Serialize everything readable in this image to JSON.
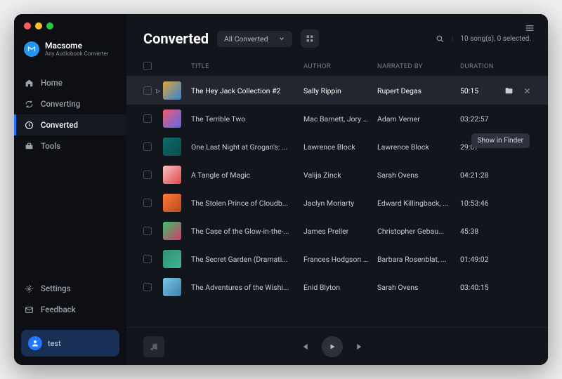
{
  "brand": {
    "name": "Macsome",
    "subtitle": "Any Audiobook Converter"
  },
  "nav": {
    "home": "Home",
    "converting": "Converting",
    "converted": "Converted",
    "tools": "Tools",
    "settings": "Settings",
    "feedback": "Feedback"
  },
  "user": {
    "name": "test"
  },
  "page": {
    "title": "Converted",
    "filter_label": "All Converted",
    "status_count": "10 song(s), 0 selected."
  },
  "columns": {
    "title": "TITLE",
    "author": "Author",
    "narrated": "Narrated by",
    "duration": "DURATION"
  },
  "tooltip": {
    "show_in_finder": "Show in Finder"
  },
  "rows": [
    {
      "title": "The Hey Jack Collection #2",
      "author": "Sally Rippin",
      "narrated": "Rupert Degas",
      "duration": "50:15",
      "art": "#e6a23c",
      "art2": "#2b86d9",
      "active": true
    },
    {
      "title": "The Terrible Two",
      "author": "Mac Barnett, Jory J...",
      "narrated": "Adam Verner",
      "duration": "03:22:57",
      "art": "#f05b6a",
      "art2": "#5b6af0"
    },
    {
      "title": "One Last Night at Grogan's: ...",
      "author": "Lawrence Block",
      "narrated": "Lawrence Block",
      "duration": "29:07",
      "art": "#0e6b6b",
      "art2": "#0a4d4d"
    },
    {
      "title": "A Tangle of Magic",
      "author": "Valija Zinck",
      "narrated": "Sarah Ovens",
      "duration": "04:21:28",
      "art": "#f6c1c1",
      "art2": "#e04a4a"
    },
    {
      "title": "The Stolen Prince of Cloudb...",
      "author": "Jaclyn Moriarty",
      "narrated": "Edward Killingback, ...",
      "duration": "10:53:46",
      "art": "#ff7a3c",
      "art2": "#b84a1a"
    },
    {
      "title": "The Case of the Glow-in-the-...",
      "author": "James Preller",
      "narrated": "Christopher Gebau...",
      "duration": "45:38",
      "art": "#36c26b",
      "art2": "#d83c6b"
    },
    {
      "title": "The Secret Garden (Dramati...",
      "author": "Frances Hodgson B...",
      "narrated": "Barbara Rosenblat, ...",
      "duration": "01:49:02",
      "art": "#2f8f6f",
      "art2": "#3cb895"
    },
    {
      "title": "The Adventures of the Wishi...",
      "author": "Enid Blyton",
      "narrated": "Sarah Ovens",
      "duration": "03:40:15",
      "art": "#7cc6e8",
      "art2": "#3a7fa8"
    }
  ]
}
